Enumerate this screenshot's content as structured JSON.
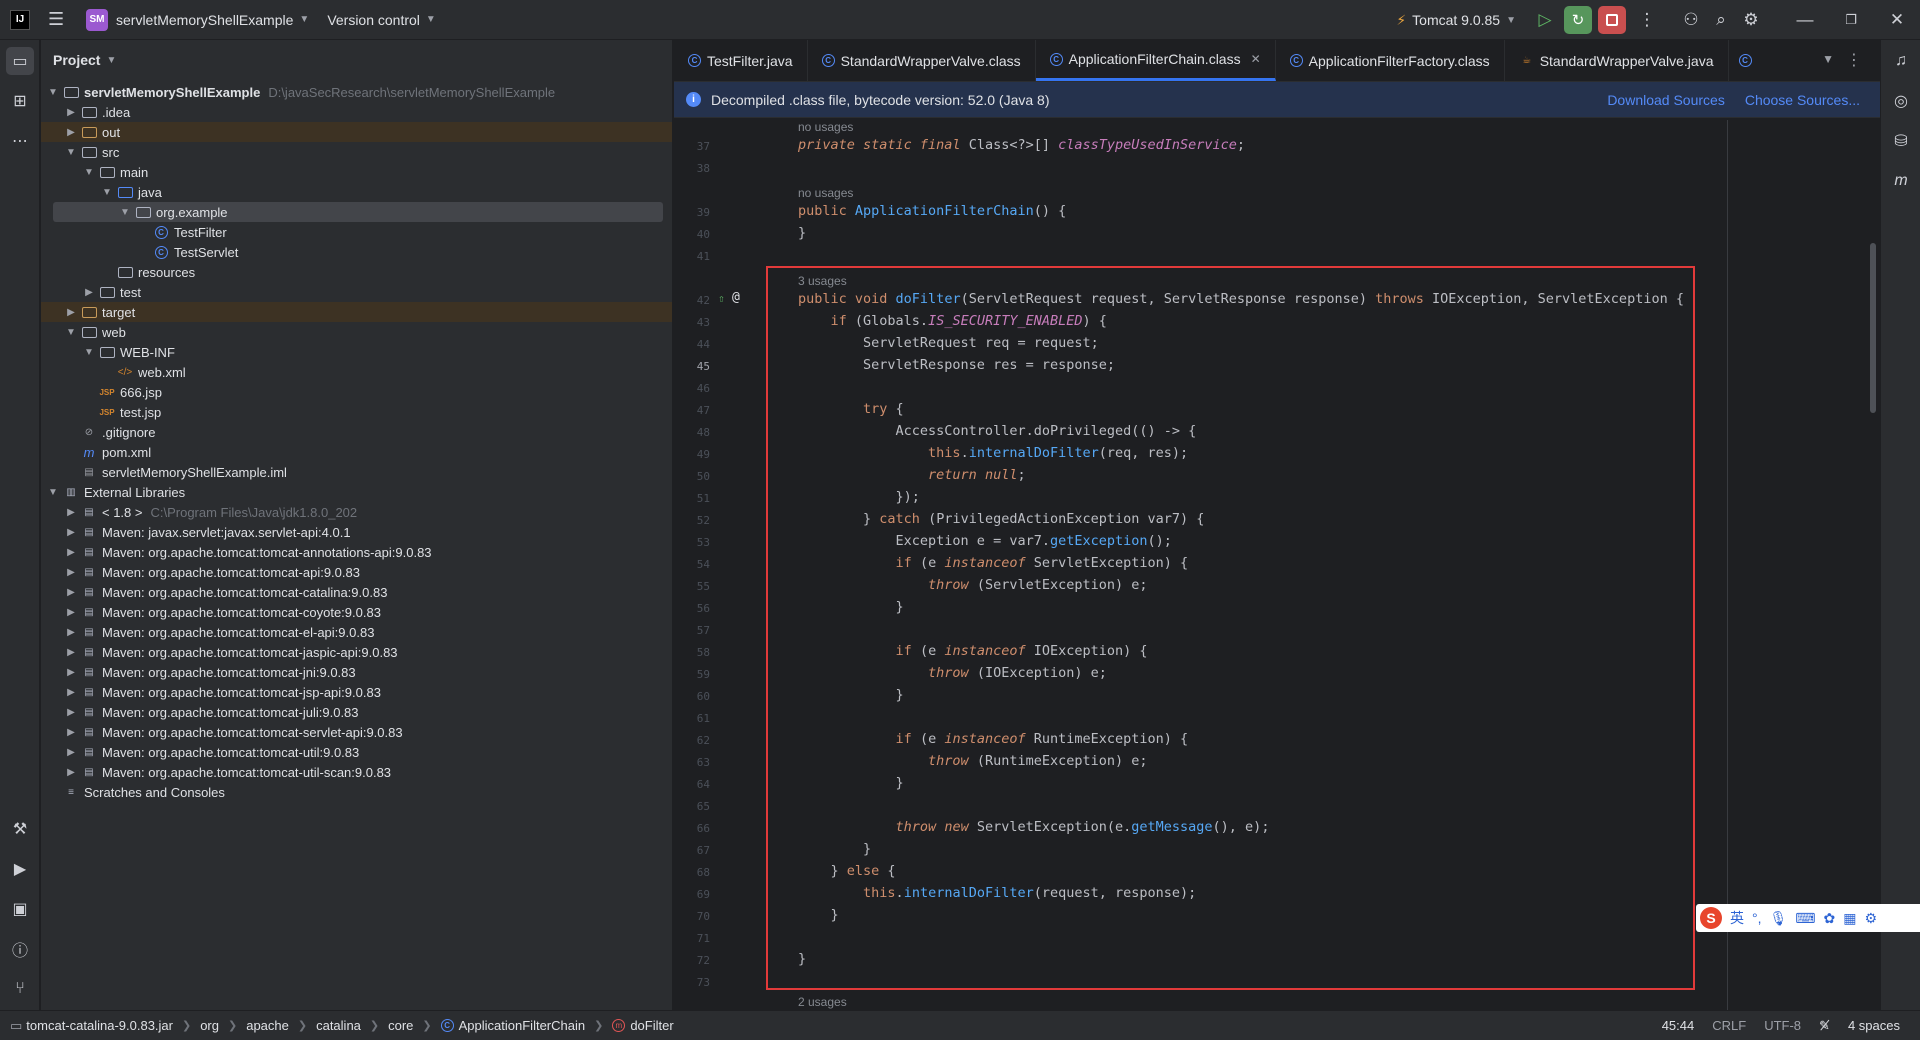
{
  "titlebar": {
    "project_badge": "SM",
    "project_name": "servletMemoryShellExample",
    "vcs": "Version control",
    "run_config": "Tomcat 9.0.85"
  },
  "project_panel": {
    "title": "Project",
    "root_name": "servletMemoryShellExample",
    "root_path": "D:\\javaSecResearch\\servletMemoryShellExample",
    "items": [
      {
        "label": ".idea"
      },
      {
        "label": "out"
      },
      {
        "label": "src"
      },
      {
        "label": "main"
      },
      {
        "label": "java"
      },
      {
        "label": "org.example"
      },
      {
        "label": "TestFilter"
      },
      {
        "label": "TestServlet"
      },
      {
        "label": "resources"
      },
      {
        "label": "test"
      },
      {
        "label": "target"
      },
      {
        "label": "web"
      },
      {
        "label": "WEB-INF"
      },
      {
        "label": "web.xml"
      },
      {
        "label": "666.jsp"
      },
      {
        "label": "test.jsp"
      },
      {
        "label": ".gitignore"
      },
      {
        "label": "pom.xml"
      },
      {
        "label": "servletMemoryShellExample.iml"
      },
      {
        "label": "External Libraries"
      },
      {
        "label": "< 1.8 >",
        "path": "C:\\Program Files\\Java\\jdk1.8.0_202"
      },
      {
        "label": "Maven: javax.servlet:javax.servlet-api:4.0.1"
      },
      {
        "label": "Maven: org.apache.tomcat:tomcat-annotations-api:9.0.83"
      },
      {
        "label": "Maven: org.apache.tomcat:tomcat-api:9.0.83"
      },
      {
        "label": "Maven: org.apache.tomcat:tomcat-catalina:9.0.83"
      },
      {
        "label": "Maven: org.apache.tomcat:tomcat-coyote:9.0.83"
      },
      {
        "label": "Maven: org.apache.tomcat:tomcat-el-api:9.0.83"
      },
      {
        "label": "Maven: org.apache.tomcat:tomcat-jaspic-api:9.0.83"
      },
      {
        "label": "Maven: org.apache.tomcat:tomcat-jni:9.0.83"
      },
      {
        "label": "Maven: org.apache.tomcat:tomcat-jsp-api:9.0.83"
      },
      {
        "label": "Maven: org.apache.tomcat:tomcat-juli:9.0.83"
      },
      {
        "label": "Maven: org.apache.tomcat:tomcat-servlet-api:9.0.83"
      },
      {
        "label": "Maven: org.apache.tomcat:tomcat-util:9.0.83"
      },
      {
        "label": "Maven: org.apache.tomcat:tomcat-util-scan:9.0.83"
      },
      {
        "label": "Scratches and Consoles"
      }
    ]
  },
  "tabs": [
    {
      "label": "TestFilter.java"
    },
    {
      "label": "StandardWrapperValve.class"
    },
    {
      "label": "ApplicationFilterChain.class"
    },
    {
      "label": "ApplicationFilterFactory.class"
    },
    {
      "label": "StandardWrapperValve.java"
    }
  ],
  "banner": {
    "text": "Decompiled .class file, bytecode version: 52.0 (Java 8)",
    "download": "Download Sources",
    "choose": "Choose Sources..."
  },
  "code": {
    "hint_no_usages_1": "no usages",
    "hint_no_usages_2": "no usages",
    "hint_3_usages": "3 usages",
    "hint_2_usages": "2 usages",
    "lines": [
      {
        "n": "37",
        "text": "private static final Class<?>[] classTypeUsedInService;"
      },
      {
        "n": "38",
        "text": ""
      },
      {
        "n": "39",
        "text": "public ApplicationFilterChain() {"
      },
      {
        "n": "40",
        "text": "}"
      },
      {
        "n": "41",
        "text": ""
      },
      {
        "n": "42",
        "text": "public void doFilter(ServletRequest request, ServletResponse response) throws IOException, ServletException {"
      },
      {
        "n": "43",
        "text": "    if (Globals.IS_SECURITY_ENABLED) {"
      },
      {
        "n": "44",
        "text": "        ServletRequest req = request;"
      },
      {
        "n": "45",
        "text": "        ServletResponse res = response;"
      },
      {
        "n": "46",
        "text": ""
      },
      {
        "n": "47",
        "text": "        try {"
      },
      {
        "n": "48",
        "text": "            AccessController.doPrivileged(() -> {"
      },
      {
        "n": "49",
        "text": "                this.internalDoFilter(req, res);"
      },
      {
        "n": "50",
        "text": "                return null;"
      },
      {
        "n": "51",
        "text": "            });"
      },
      {
        "n": "52",
        "text": "        } catch (PrivilegedActionException var7) {"
      },
      {
        "n": "53",
        "text": "            Exception e = var7.getException();"
      },
      {
        "n": "54",
        "text": "            if (e instanceof ServletException) {"
      },
      {
        "n": "55",
        "text": "                throw (ServletException) e;"
      },
      {
        "n": "56",
        "text": "            }"
      },
      {
        "n": "57",
        "text": ""
      },
      {
        "n": "58",
        "text": "            if (e instanceof IOException) {"
      },
      {
        "n": "59",
        "text": "                throw (IOException) e;"
      },
      {
        "n": "60",
        "text": "            }"
      },
      {
        "n": "61",
        "text": ""
      },
      {
        "n": "62",
        "text": "            if (e instanceof RuntimeException) {"
      },
      {
        "n": "63",
        "text": "                throw (RuntimeException) e;"
      },
      {
        "n": "64",
        "text": "            }"
      },
      {
        "n": "65",
        "text": ""
      },
      {
        "n": "66",
        "text": "            throw new ServletException(e.getMessage(), e);"
      },
      {
        "n": "67",
        "text": "        }"
      },
      {
        "n": "68",
        "text": "    } else {"
      },
      {
        "n": "69",
        "text": "        this.internalDoFilter(request, response);"
      },
      {
        "n": "70",
        "text": "    }"
      },
      {
        "n": "71",
        "text": ""
      },
      {
        "n": "72",
        "text": "}"
      },
      {
        "n": "73",
        "text": ""
      }
    ]
  },
  "statusbar": {
    "breadcrumb": [
      "tomcat-catalina-9.0.83.jar",
      "org",
      "apache",
      "catalina",
      "core",
      "ApplicationFilterChain",
      "doFilter"
    ],
    "position": "45:44",
    "line_sep": "CRLF",
    "encoding": "UTF-8",
    "indent": "4 spaces"
  },
  "ime": {
    "logo": "S",
    "lang": "英"
  }
}
